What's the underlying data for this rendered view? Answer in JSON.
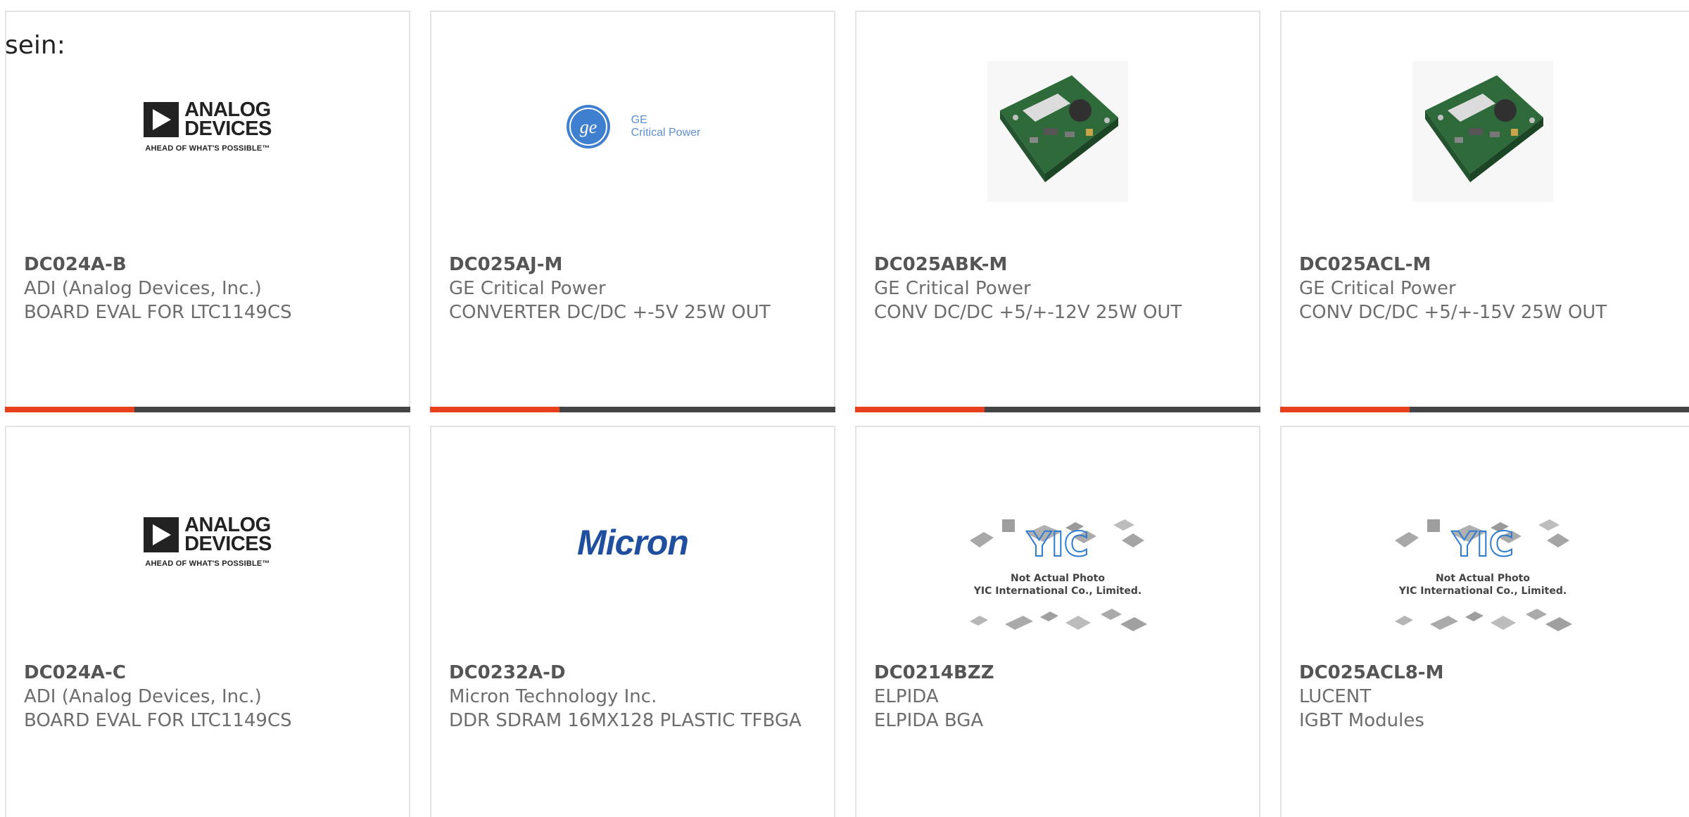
{
  "intro_text": "sein:",
  "colors": {
    "accent": "#e8401c",
    "bar": "#444444",
    "card_border": "#e3e3e3"
  },
  "products": [
    {
      "part_number": "DC024A-B",
      "manufacturer": "ADI (Analog Devices, Inc.)",
      "description": "BOARD EVAL FOR LTC1149CS",
      "image": "analog-devices-logo",
      "logo": {
        "line1": "ANALOG",
        "line2": "DEVICES",
        "tagline": "AHEAD OF WHAT'S POSSIBLE™"
      }
    },
    {
      "part_number": "DC025AJ-M",
      "manufacturer": "GE Critical Power",
      "description": "CONVERTER DC/DC +-5V 25W OUT",
      "image": "ge-critical-power-logo",
      "logo": {
        "line1": "GE",
        "line2": "Critical Power",
        "emblem": "ge"
      }
    },
    {
      "part_number": "DC025ABK-M",
      "manufacturer": "GE Critical Power",
      "description": "CONV DC/DC +5/+-12V 25W OUT",
      "image": "pcb-board-photo"
    },
    {
      "part_number": "DC025ACL-M",
      "manufacturer": "GE Critical Power",
      "description": "CONV DC/DC +5/+-15V 25W OUT",
      "image": "pcb-board-photo"
    },
    {
      "part_number": "DC024A-C",
      "manufacturer": "ADI (Analog Devices, Inc.)",
      "description": "BOARD EVAL FOR LTC1149CS",
      "image": "analog-devices-logo",
      "logo": {
        "line1": "ANALOG",
        "line2": "DEVICES",
        "tagline": "AHEAD OF WHAT'S POSSIBLE™"
      }
    },
    {
      "part_number": "DC0232A-D",
      "manufacturer": "Micron Technology Inc.",
      "description": "DDR SDRAM 16MX128 PLASTIC TFBGA",
      "image": "micron-logo",
      "logo": {
        "text": "Micron"
      }
    },
    {
      "part_number": "DC0214BZZ",
      "manufacturer": "ELPIDA",
      "description": "ELPIDA BGA",
      "image": "yic-placeholder",
      "placeholder": {
        "mark": "YIC",
        "line1": "Not Actual Photo",
        "line2": "YIC International Co., Limited."
      }
    },
    {
      "part_number": "DC025ACL8-M",
      "manufacturer": "LUCENT",
      "description": "IGBT Modules",
      "image": "yic-placeholder",
      "placeholder": {
        "mark": "YIC",
        "line1": "Not Actual Photo",
        "line2": "YIC International Co., Limited."
      }
    }
  ]
}
